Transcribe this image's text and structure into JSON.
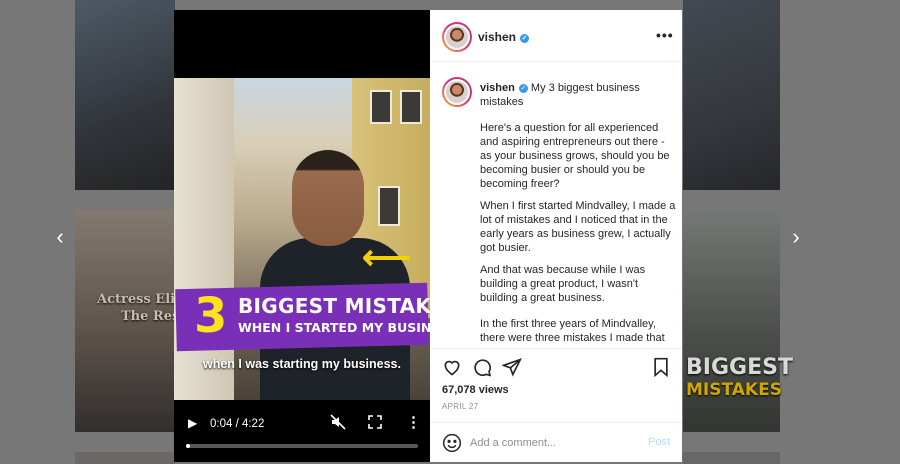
{
  "background": {
    "captions": [
      "Actress Elis",
      "The Res",
      "BIGGEST",
      "MISTAKES"
    ]
  },
  "video": {
    "overlay_number": "3",
    "overlay_line1": "BIGGEST MISTAKES",
    "overlay_line2": "WHEN I STARTED MY BUSINESS",
    "subtitle": "when I was starting my business.",
    "time": "0:04 / 4:22",
    "progress": 0.016,
    "icons": {
      "play": "play-icon",
      "mute": "muted-speaker-icon",
      "fullscreen": "fullscreen-icon",
      "more": "vertical-dots-icon"
    }
  },
  "post": {
    "username": "vishen",
    "verified": true,
    "caption_title": "My 3 biggest business mistakes",
    "paragraphs": [
      "Here's a question for all experienced and aspiring entrepreneurs out there - as your business grows, should you be becoming busier or should you be becoming freer?",
      "When I first started Mindvalley, I made a lot of mistakes and I noticed that in the early years as business grew, I actually got busier.",
      "And that was because while I was building a great product, I wasn't building a great business.",
      "In the first three years of Mindvalley, there were three mistakes I made that"
    ],
    "views": "67,078 views",
    "date": "APRIL 27",
    "comment_placeholder": "Add a comment...",
    "post_label": "Post",
    "colors": {
      "verified": "#3897f0",
      "post_disabled": "#b2dffc",
      "banner": "#7a2fb8",
      "overlay_yellow": "#ffe21a"
    }
  },
  "nav": {
    "prev": "‹",
    "next": "›"
  }
}
